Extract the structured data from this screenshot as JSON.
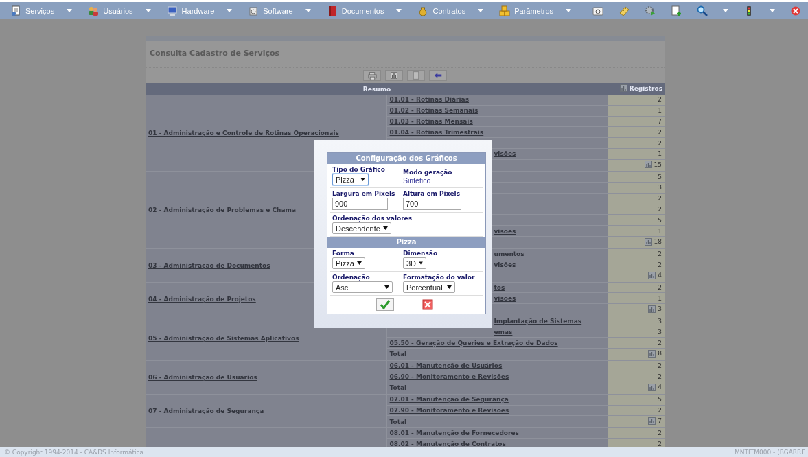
{
  "menu": {
    "items": [
      {
        "label": "Serviços",
        "dropdown": true
      },
      {
        "label": "Usuários",
        "dropdown": true
      },
      {
        "label": "Hardware",
        "dropdown": true
      },
      {
        "label": "Software",
        "dropdown": true
      },
      {
        "label": "Documentos",
        "dropdown": true
      },
      {
        "label": "Contratos",
        "dropdown": true
      },
      {
        "label": "Parâmetros",
        "dropdown": true
      }
    ],
    "tools": [
      {
        "dropdown": false
      },
      {
        "dropdown": false
      },
      {
        "dropdown": false
      },
      {
        "dropdown": false
      },
      {
        "dropdown": true
      },
      {
        "dropdown": true
      },
      {
        "dropdown": false
      }
    ]
  },
  "panel": {
    "title": "Consulta Cadastro de Serviços",
    "table": {
      "columns": [
        "Resumo",
        "Registros"
      ],
      "groups": [
        {
          "name": "01 - Administração e Controle de Rotinas Operacionais",
          "rows": [
            {
              "kind": "link",
              "label": "01.01 - Rotinas Diárias",
              "value": "2"
            },
            {
              "kind": "link",
              "label": "01.02 - Rotinas Semanais",
              "value": "1"
            },
            {
              "kind": "link",
              "label": "01.03 - Rotinas Mensais",
              "value": "7"
            },
            {
              "kind": "link",
              "label": "01.04 - Rotinas Trimestrais",
              "value": "2"
            },
            {
              "kind": "blank",
              "value": "2"
            },
            {
              "kind": "clipped",
              "label": "visões",
              "value": "1"
            },
            {
              "kind": "total",
              "value": "15"
            }
          ]
        },
        {
          "name": "02 - Administração de Problemas e Chama",
          "rows": [
            {
              "kind": "blank",
              "value": "5"
            },
            {
              "kind": "blank",
              "value": "3"
            },
            {
              "kind": "blank",
              "value": "2"
            },
            {
              "kind": "blank",
              "value": "2"
            },
            {
              "kind": "blank",
              "value": "5"
            },
            {
              "kind": "clipped",
              "label": "visões",
              "value": "1"
            },
            {
              "kind": "total",
              "value": "18"
            }
          ]
        },
        {
          "name": "03 - Administração de Documentos",
          "rows": [
            {
              "kind": "clipped",
              "label": "umentos",
              "value": "2"
            },
            {
              "kind": "clipped",
              "label": "visões",
              "value": "2"
            },
            {
              "kind": "total",
              "value": "4"
            }
          ]
        },
        {
          "name": "04 - Administração de Projetos",
          "rows": [
            {
              "kind": "clipped",
              "label": "tos",
              "value": "2"
            },
            {
              "kind": "clipped",
              "label": "visões",
              "value": "1"
            },
            {
              "kind": "total",
              "value": "3"
            }
          ]
        },
        {
          "name": "05 - Administração de Sistemas Aplicativos",
          "rows": [
            {
              "kind": "clipped",
              "label": "Implantação de Sistemas",
              "value": "3"
            },
            {
              "kind": "clipped",
              "label": "emas",
              "value": "3"
            },
            {
              "kind": "link",
              "label": "05.50 - Geração de Queries e Extração de Dados",
              "value": "2"
            },
            {
              "kind": "total",
              "label": "Total",
              "value": "8"
            }
          ]
        },
        {
          "name": "06 - Administração de Usuários",
          "rows": [
            {
              "kind": "link",
              "label": "06.01 - Manutenção de Usuários",
              "value": "2"
            },
            {
              "kind": "link",
              "label": "06.90 - Monitoramento e Revisões",
              "value": "2"
            },
            {
              "kind": "total",
              "label": "Total",
              "value": "4"
            }
          ]
        },
        {
          "name": "07 - Administração de Segurança",
          "rows": [
            {
              "kind": "link",
              "label": "07.01 - Manutenção de Segurança",
              "value": "5"
            },
            {
              "kind": "link",
              "label": "07.90 - Monitoramento e Revisões",
              "value": "2"
            },
            {
              "kind": "total",
              "label": "Total",
              "value": "7"
            }
          ]
        },
        {
          "rows": [
            {
              "kind": "link",
              "label": "08.01 - Manutenção de Fornecedores",
              "value": "2"
            },
            {
              "kind": "link",
              "label": "08.02 - Manutenção de Contratos",
              "value": "2"
            }
          ]
        }
      ]
    }
  },
  "dialog": {
    "title": "Configuração dos Gráficos",
    "rows": [
      [
        {
          "kind": "select",
          "label": "Tipo do Gráfico",
          "value": "Pizza",
          "focused": true
        },
        {
          "kind": "text",
          "label": "Modo geração",
          "value": "Sintético"
        }
      ],
      [
        {
          "kind": "input",
          "label": "Largura em Pixels",
          "value": "900"
        },
        {
          "kind": "input",
          "label": "Altura em Pixels",
          "value": "700"
        }
      ],
      [
        {
          "kind": "select",
          "label": "Ordenação dos valores",
          "value": "Descendente",
          "focused": false
        }
      ]
    ],
    "section": "Pizza",
    "section_rows": [
      [
        {
          "kind": "select",
          "label": "Forma",
          "value": "Pizza",
          "focused": false
        },
        {
          "kind": "select",
          "label": "Dimensão",
          "value": "3D",
          "focused": false
        }
      ],
      [
        {
          "kind": "select",
          "label": "Ordenação",
          "value": "Asc",
          "focused": false
        },
        {
          "kind": "select",
          "label": "Formatação do valor",
          "value": "Percentual",
          "focused": false
        }
      ]
    ]
  },
  "footer": {
    "copyright": "© Copyright 1994-2014 - CA&DS Informática",
    "user": "MNTITM000 - (BGARRE"
  }
}
